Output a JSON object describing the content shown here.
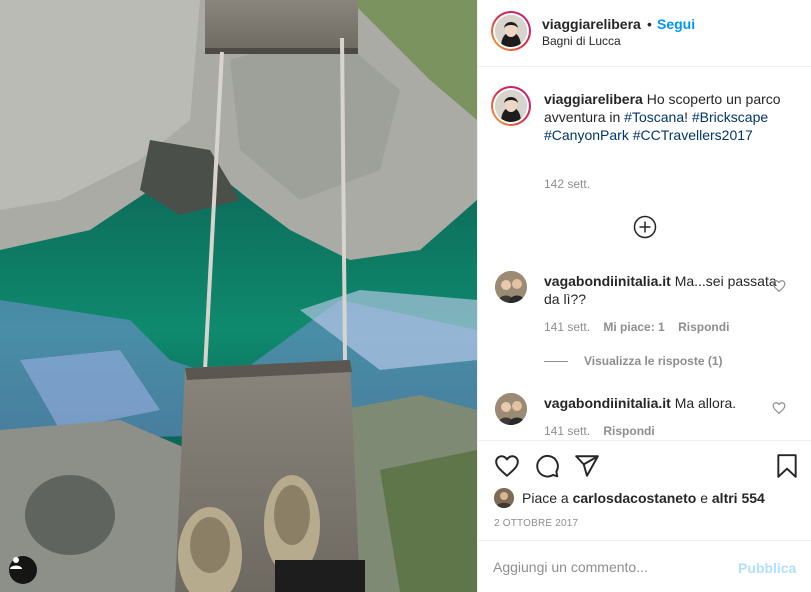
{
  "post": {
    "username": "viaggiarelibera",
    "separator": "•",
    "follow_label": "Segui",
    "location": "Bagni di Lucca"
  },
  "caption": {
    "username": "viaggiarelibera",
    "text": "Ho scoperto un parco avventura in",
    "tag_toscana": "#Toscana",
    "exclaim": "!",
    "tag_brickscape": "#Brickscape",
    "tag_canyonpark": "#CanyonPark",
    "tag_cctravellers": "#CCTravellers2017",
    "time": "142 sett."
  },
  "load_more_icon": "plus-circle-icon",
  "comments": [
    {
      "username": "vagabondiinitalia.it",
      "text": "Ma...sei passata da lì??",
      "time": "141 sett.",
      "likes": "Mi piace: 1",
      "reply": "Rispondi",
      "view_replies": "Visualizza le risposte (1)"
    },
    {
      "username": "vagabondiinitalia.it",
      "text": "Ma allora.",
      "time": "141 sett.",
      "reply": "Rispondi"
    }
  ],
  "actions": {
    "icons": [
      "heart-icon",
      "comment-icon",
      "share-icon",
      "bookmark-icon"
    ]
  },
  "likes": {
    "prefix": "Piace a",
    "user": "carlosdacostaneto",
    "and": "e",
    "others": "altri 554"
  },
  "date": "2 OTTOBRE 2017",
  "add_comment": {
    "placeholder": "Aggiungi un commento...",
    "post_label": "Pubblica"
  },
  "colors": {
    "link_blue": "#0095f6",
    "hashtag": "#00376b",
    "muted": "#8e8e8e",
    "post_disabled": "#b2dffc",
    "border": "#efefef"
  }
}
